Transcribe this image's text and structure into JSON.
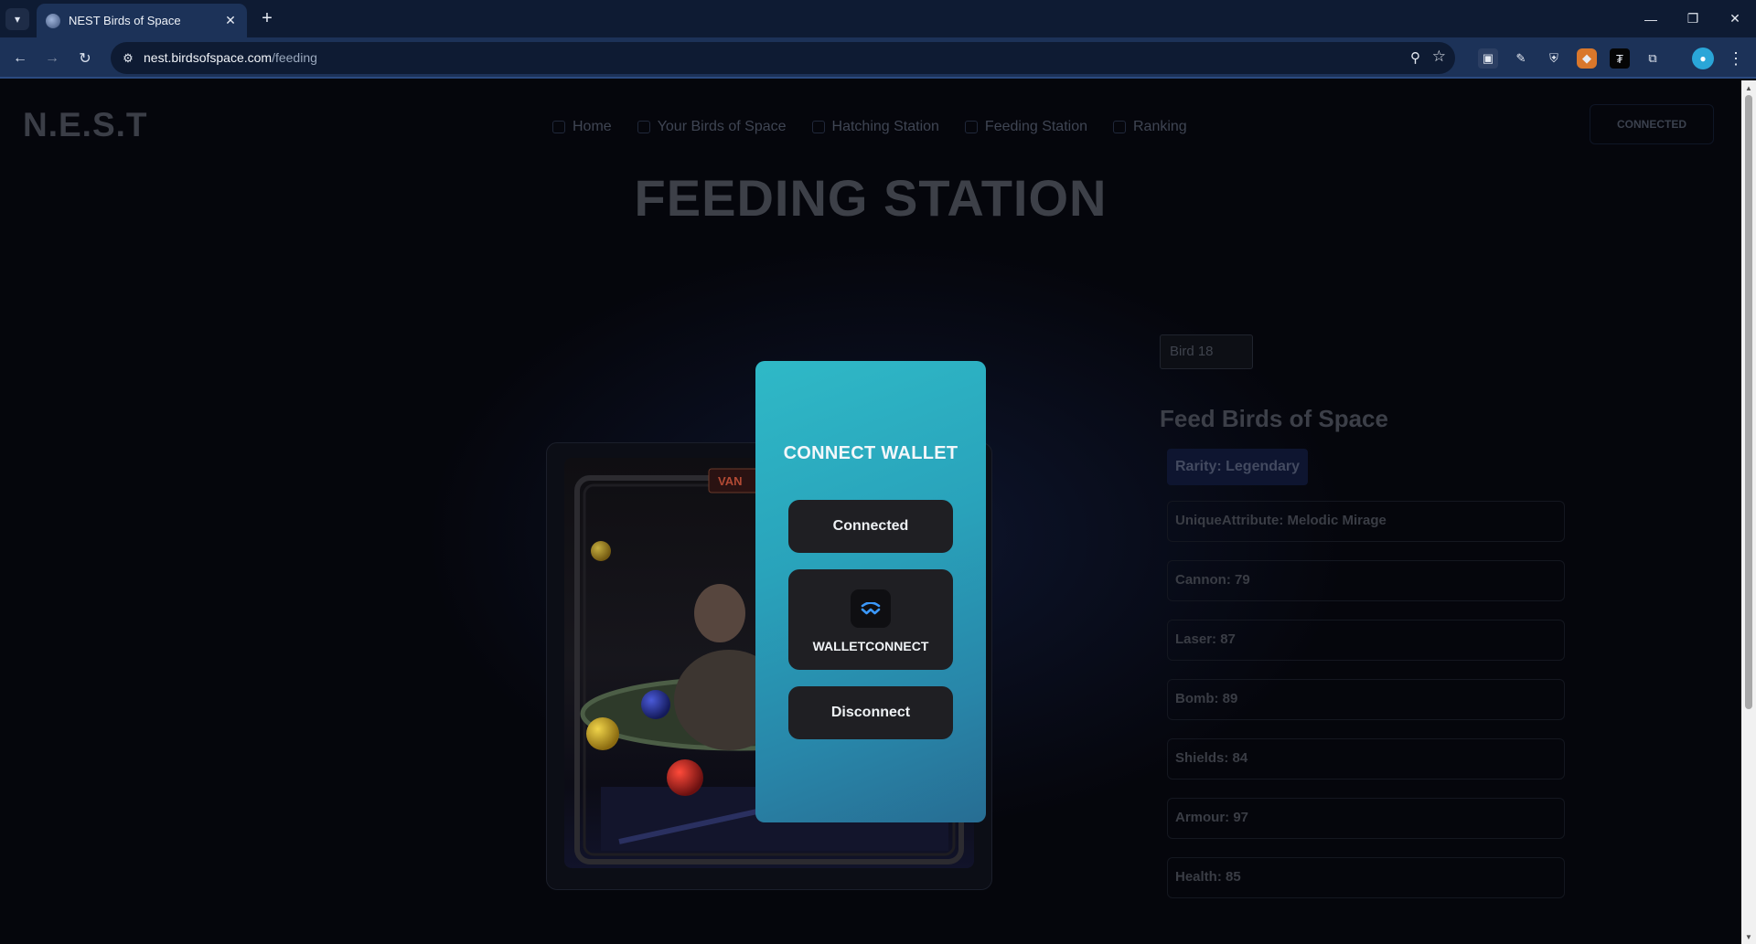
{
  "browser": {
    "tab_title": "NEST Birds of Space",
    "url_host": "nest.birdsofspace.com",
    "url_path": "/feeding"
  },
  "header": {
    "brand": "N.E.S.T",
    "nav": [
      {
        "label": "Home"
      },
      {
        "label": "Your Birds of Space"
      },
      {
        "label": "Hatching Station"
      },
      {
        "label": "Feeding Station"
      },
      {
        "label": "Ranking"
      }
    ],
    "connection_button": "CONNECTED"
  },
  "main": {
    "title": "FEEDING STATION",
    "bird_select": "Bird 18",
    "panel_title": "Feed Birds of Space",
    "rarity": "Rarity: Legendary",
    "stats": [
      "UniqueAttribute: Melodic Mirage",
      "Cannon: 79",
      "Laser: 87",
      "Bomb: 89",
      "Shields: 84",
      "Armour: 97",
      "Health: 85"
    ],
    "card_sign_text": "VAN"
  },
  "modal": {
    "title": "CONNECT WALLET",
    "connected_label": "Connected",
    "walletconnect_label": "WALLETCONNECT",
    "disconnect_label": "Disconnect"
  },
  "colors": {
    "modal_gradient_start": "#2fb9c7",
    "modal_gradient_end": "#276d93",
    "modal_button_bg": "#1f1f23",
    "walletconnect_blue": "#3b99fc"
  },
  "icons": {
    "walletconnect": "walletconnect-icon",
    "search": "zoom-icon",
    "bookmark": "star-icon"
  }
}
